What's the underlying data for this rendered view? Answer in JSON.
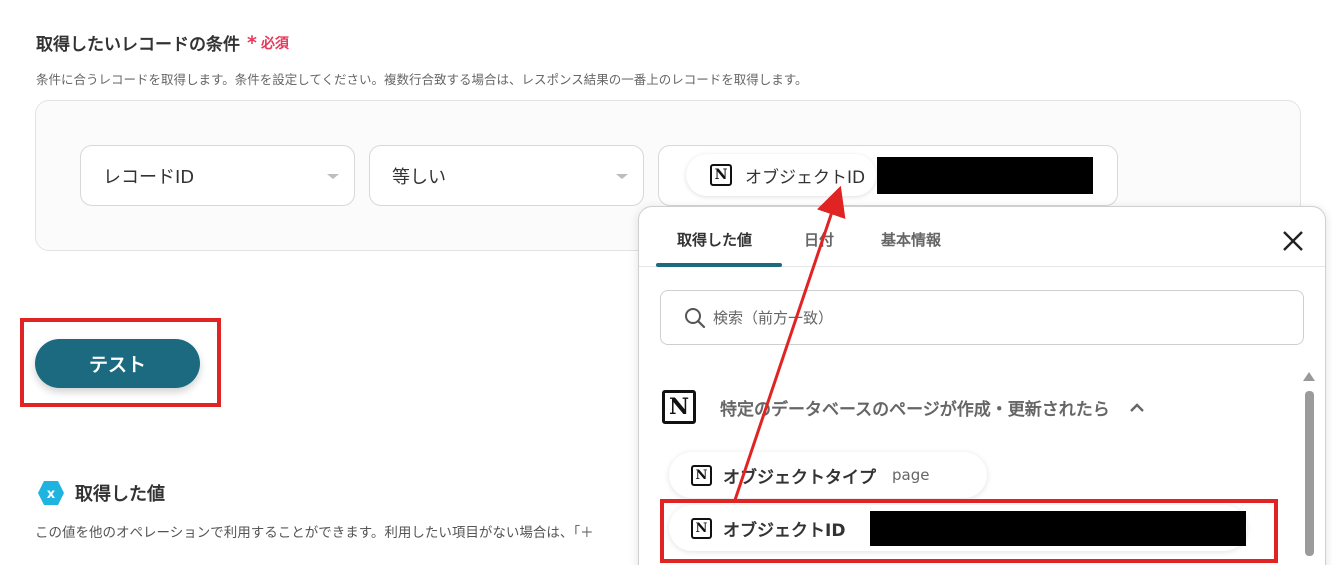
{
  "condition": {
    "title": "取得したいレコードの条件",
    "required_mark": "*",
    "required_label": "必須",
    "description": "条件に合うレコードを取得します。条件を設定してください。複数行合致する場合は、レスポンス結果の一番上のレコードを取得します。",
    "field_select": "レコードID",
    "operator_select": "等しい",
    "value_chip_label": "オブジェクトID"
  },
  "test_button": "テスト",
  "acquired": {
    "title": "取得した値",
    "description": "この値を他のオペレーションで利用することができます。利用したい項目がない場合は、「＋"
  },
  "popup": {
    "tabs": [
      "取得した値",
      "日付",
      "基本情報"
    ],
    "search_placeholder": "検索（前方一致）",
    "group_title": "特定のデータベースのページが作成・更新されたら",
    "items": [
      {
        "label": "オブジェクトタイプ",
        "value": "page"
      },
      {
        "label": "オブジェクトID",
        "value": ""
      }
    ]
  },
  "colors": {
    "accent": "#1b6a80",
    "required": "#e8385b",
    "annotation_red": "#e02424"
  },
  "icons": {
    "notion": "notion-icon",
    "search": "search-icon",
    "close": "close-icon",
    "chevron": "chevron-up-icon",
    "acquired": "variable-icon"
  }
}
